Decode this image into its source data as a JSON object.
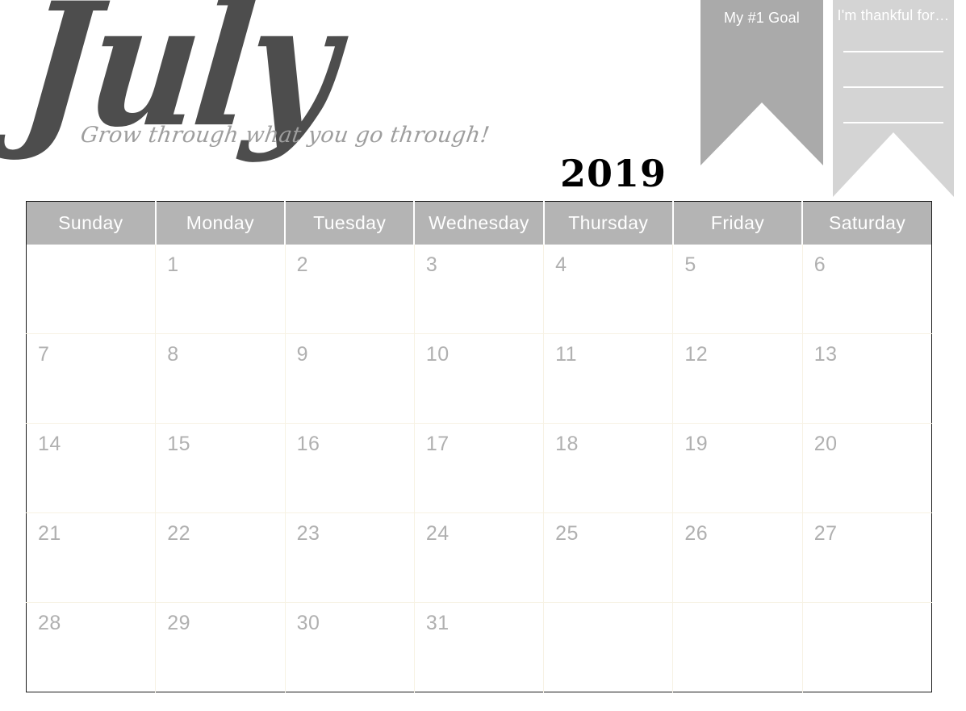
{
  "header": {
    "month": "July",
    "tagline": "Grow through what you go through!",
    "year": "2019"
  },
  "ribbons": [
    {
      "id": "goal",
      "title": "My #1 Goal",
      "color": "#aaaaaa",
      "lines": 0
    },
    {
      "id": "thankful",
      "title": "I'm thankful for…",
      "color": "#d4d4d4",
      "lines": 3
    }
  ],
  "calendar": {
    "month": "July",
    "year": "2019",
    "header_bg": "#b4b4b4",
    "grid_line_color": "#f7f2e4",
    "date_text_color": "#b0b0b0",
    "day_headers": [
      "Sunday",
      "Monday",
      "Tuesday",
      "Wednesday",
      "Thursday",
      "Friday",
      "Saturday"
    ],
    "weeks": [
      [
        "",
        "1",
        "2",
        "3",
        "4",
        "5",
        "6"
      ],
      [
        "7",
        "8",
        "9",
        "10",
        "11",
        "12",
        "13"
      ],
      [
        "14",
        "15",
        "16",
        "17",
        "18",
        "19",
        "20"
      ],
      [
        "21",
        "22",
        "23",
        "24",
        "25",
        "26",
        "27"
      ],
      [
        "28",
        "29",
        "30",
        "31",
        "",
        "",
        ""
      ]
    ]
  }
}
